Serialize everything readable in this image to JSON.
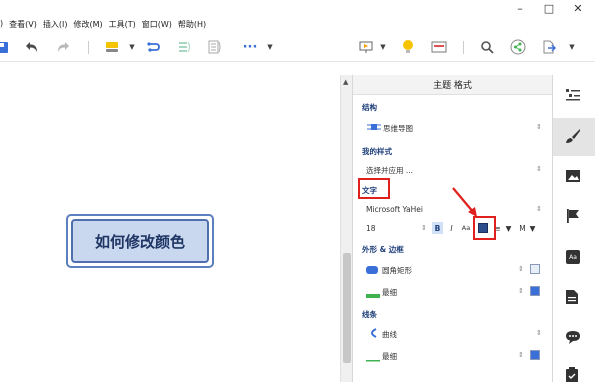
{
  "menu": {
    "items": [
      ") ",
      "查看(V)",
      "插入(I)",
      "修改(M)",
      "工具(T)",
      "窗口(W)",
      "帮助(H)"
    ]
  },
  "window_controls": {
    "minimize": "–",
    "maximize": "□",
    "close": "✕"
  },
  "toolbar": {
    "more_label": "···"
  },
  "canvas": {
    "topic_text": "如何修改颜色"
  },
  "panel": {
    "header": "主题 格式",
    "structure": {
      "title": "结构",
      "value": "思维导图"
    },
    "my_style": {
      "title": "我的样式",
      "value": "选择并应用 ..."
    },
    "text": {
      "title": "文字",
      "font": "Microsoft YaHei",
      "size": "18",
      "bold": "B",
      "italic": "I",
      "case": "Aa",
      "align": "≡",
      "more": "M"
    },
    "shape_border": {
      "title": "外形 & 边框",
      "shape_value": "圆角矩形",
      "border_value": "最细"
    },
    "line": {
      "title": "线条",
      "line_value": "曲线",
      "width_value": "最细"
    }
  },
  "colors": {
    "accent": "#3b6fd8",
    "topic_fill": "#c9d8ee",
    "topic_border": "#4f6fae",
    "text_color_swatch": "#2d4d8c",
    "highlight": "#e0201c",
    "bulb": "#f5c400",
    "green": "#3fb34f"
  }
}
